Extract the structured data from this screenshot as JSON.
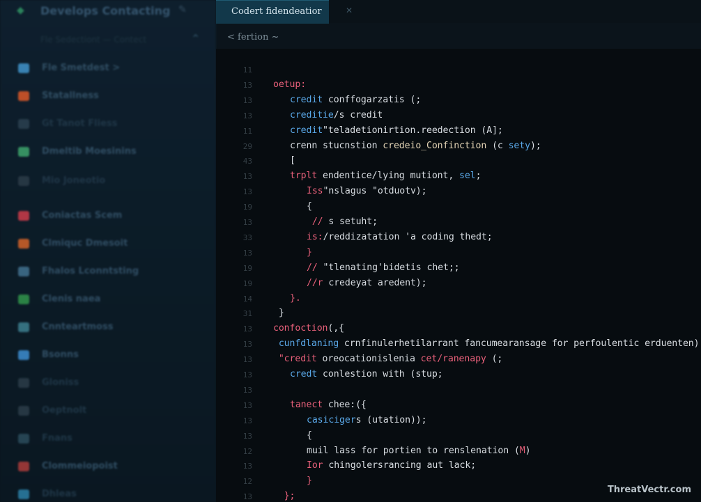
{
  "sidebar": {
    "title": "Develops Contacting",
    "search_placeholder": "Fle Sedectiont — Contect",
    "items": [
      {
        "label": "Fle Smetdest >",
        "icon": "file-icon",
        "color": "#3e8fc4",
        "dim": false
      },
      {
        "label": "Statallness",
        "icon": "check-icon",
        "color": "#d2562a",
        "dim": false
      },
      {
        "label": "Gt  Tanot Fliess",
        "icon": "folder-icon",
        "color": "#2a4050",
        "dim": true
      },
      {
        "label": "Dmeltib Moesinins",
        "icon": "grid-icon",
        "color": "#3b9e6a",
        "dim": false
      },
      {
        "label": "Mio Joneotio",
        "icon": "dot-icon",
        "color": "#2a3b48",
        "dim": true
      },
      {
        "label": "Coniactas Scem",
        "icon": "heart-icon",
        "color": "#c43b4a",
        "dim": false
      },
      {
        "label": "Clmiquc Dmesoit",
        "icon": "shield-icon",
        "color": "#c8602a",
        "dim": false
      },
      {
        "label": "Fhalos Lconntsting",
        "icon": "chart-icon",
        "color": "#3f6d8a",
        "dim": false
      },
      {
        "label": "Clenis naea",
        "icon": "box-icon",
        "color": "#2f8e4a",
        "dim": false
      },
      {
        "label": "Cnnteartmoss",
        "icon": "circle-icon",
        "color": "#3a7a8a",
        "dim": false
      },
      {
        "label": "Bsonns",
        "icon": "pin-icon",
        "color": "#3a88c8",
        "dim": false
      },
      {
        "label": "Gloniss",
        "icon": "layers-icon",
        "color": "#2a3b48",
        "dim": true
      },
      {
        "label": "Oeptnolt",
        "icon": "dot-icon",
        "color": "#2a3b48",
        "dim": true
      },
      {
        "label": "Fnans",
        "icon": "arrow-icon",
        "color": "#2a4a5a",
        "dim": true
      },
      {
        "label": "Clommeiopoist",
        "icon": "stack-icon",
        "color": "#a33a3a",
        "dim": false
      },
      {
        "label": "Dhleas",
        "icon": "cube-icon",
        "color": "#2a7aa0",
        "dim": true
      }
    ]
  },
  "editor": {
    "tab_label": "Codert fidendeatior",
    "breadcrumb": "< fertion ~",
    "lines": [
      {
        "n": "11",
        "indent": 0,
        "tokens": []
      },
      {
        "n": "13",
        "indent": 0,
        "tokens": [
          {
            "t": "oetup:",
            "c": "#e8607a"
          }
        ]
      },
      {
        "n": "13",
        "indent": 1,
        "tokens": [
          {
            "t": "credit",
            "c": "#5aa8e8"
          },
          {
            "t": " conffogarzatis (;",
            "c": "#d8dde2"
          }
        ]
      },
      {
        "n": "13",
        "indent": 1,
        "tokens": [
          {
            "t": "creditie",
            "c": "#5aa8e8"
          },
          {
            "t": "/s credit",
            "c": "#d8dde2"
          }
        ]
      },
      {
        "n": "11",
        "indent": 1,
        "tokens": [
          {
            "t": "credit",
            "c": "#5aa8e8"
          },
          {
            "t": "\"teladetionirtion.reedection (A];",
            "c": "#d8dde2"
          }
        ]
      },
      {
        "n": "29",
        "indent": 1,
        "tokens": [
          {
            "t": "crenn",
            "c": "#d8dde2"
          },
          {
            "t": " stucnstion ",
            "c": "#d8dde2"
          },
          {
            "t": "credeio_Confinction",
            "c": "#e2d3b5"
          },
          {
            "t": " (c ",
            "c": "#d8dde2"
          },
          {
            "t": "sety",
            "c": "#5aa8e8"
          },
          {
            "t": ");",
            "c": "#d8dde2"
          }
        ]
      },
      {
        "n": "43",
        "indent": 1,
        "tokens": [
          {
            "t": "[",
            "c": "#d8dde2"
          }
        ]
      },
      {
        "n": "13",
        "indent": 1,
        "tokens": [
          {
            "t": "trplt",
            "c": "#e8607a"
          },
          {
            "t": " endentice/lying mutiont, ",
            "c": "#d8dde2"
          },
          {
            "t": "sel",
            "c": "#5aa8e8"
          },
          {
            "t": ";",
            "c": "#d8dde2"
          }
        ]
      },
      {
        "n": "13",
        "indent": 2,
        "tokens": [
          {
            "t": "Iss",
            "c": "#e8607a"
          },
          {
            "t": "\"nslagus \"otduotv);",
            "c": "#d8dde2"
          }
        ]
      },
      {
        "n": "19",
        "indent": 2,
        "tokens": [
          {
            "t": "{",
            "c": "#d8dde2"
          }
        ]
      },
      {
        "n": "13",
        "indent": 2,
        "tokens": [
          {
            "t": " //",
            "c": "#e8607a"
          },
          {
            "t": " s setuht;",
            "c": "#d8dde2"
          }
        ]
      },
      {
        "n": "33",
        "indent": 2,
        "tokens": [
          {
            "t": "is:",
            "c": "#e8607a"
          },
          {
            "t": "/reddizatation 'a coding thedt;",
            "c": "#d8dde2"
          }
        ]
      },
      {
        "n": "13",
        "indent": 2,
        "tokens": [
          {
            "t": "}",
            "c": "#e8607a"
          }
        ]
      },
      {
        "n": "19",
        "indent": 2,
        "tokens": [
          {
            "t": "//",
            "c": "#e8607a"
          },
          {
            "t": " \"tlenating'bidetis chet;;",
            "c": "#d8dde2"
          }
        ]
      },
      {
        "n": "19",
        "indent": 2,
        "tokens": [
          {
            "t": "//r",
            "c": "#e8607a"
          },
          {
            "t": " credeyat aredent);",
            "c": "#d8dde2"
          }
        ]
      },
      {
        "n": "14",
        "indent": 1,
        "tokens": [
          {
            "t": "}.",
            "c": "#e8607a"
          }
        ]
      },
      {
        "n": "31",
        "indent": 0,
        "tokens": [
          {
            "t": " }",
            "c": "#d8dde2"
          }
        ]
      },
      {
        "n": "13",
        "indent": 0,
        "tokens": [
          {
            "t": "confoction",
            "c": "#e8607a"
          },
          {
            "t": "(,{",
            "c": "#d8dde2"
          }
        ]
      },
      {
        "n": "13",
        "indent": 0,
        "tokens": [
          {
            "t": " cunfdlaning",
            "c": "#5aa8e8"
          },
          {
            "t": " crnfinulerhetilarrant fancumearansage for perfoulentic erduenten);",
            "c": "#d8dde2"
          }
        ]
      },
      {
        "n": "13",
        "indent": 0,
        "tokens": [
          {
            "t": " \"credit",
            "c": "#e8607a"
          },
          {
            "t": " oreocationislenia ",
            "c": "#d8dde2"
          },
          {
            "t": "cet/ranenapy",
            "c": "#e8607a"
          },
          {
            "t": " (;",
            "c": "#d8dde2"
          }
        ]
      },
      {
        "n": "13",
        "indent": 1,
        "tokens": [
          {
            "t": "credt",
            "c": "#5aa8e8"
          },
          {
            "t": " conlestion with (stup;",
            "c": "#d8dde2"
          }
        ]
      },
      {
        "n": "13",
        "indent": 0,
        "tokens": []
      },
      {
        "n": "13",
        "indent": 1,
        "tokens": [
          {
            "t": "tanect",
            "c": "#e8607a"
          },
          {
            "t": " chee:({",
            "c": "#d8dde2"
          }
        ]
      },
      {
        "n": "13",
        "indent": 2,
        "tokens": [
          {
            "t": "casiciger",
            "c": "#5aa8e8"
          },
          {
            "t": "s (utation));",
            "c": "#d8dde2"
          }
        ]
      },
      {
        "n": "13",
        "indent": 2,
        "tokens": [
          {
            "t": "{",
            "c": "#d8dde2"
          }
        ]
      },
      {
        "n": "12",
        "indent": 2,
        "tokens": [
          {
            "t": "muil lass for portien to renslenation (",
            "c": "#d8dde2"
          },
          {
            "t": "M",
            "c": "#e8607a"
          },
          {
            "t": ")",
            "c": "#d8dde2"
          }
        ]
      },
      {
        "n": "13",
        "indent": 2,
        "tokens": [
          {
            "t": "Ior",
            "c": "#e8607a"
          },
          {
            "t": " chingolersrancing aut lack;",
            "c": "#d8dde2"
          }
        ]
      },
      {
        "n": "12",
        "indent": 2,
        "tokens": [
          {
            "t": "}",
            "c": "#e8607a"
          }
        ]
      },
      {
        "n": "13",
        "indent": 0,
        "tokens": [
          {
            "t": "  };",
            "c": "#e8607a"
          }
        ]
      }
    ]
  },
  "watermark": "ThreatVectr.com"
}
